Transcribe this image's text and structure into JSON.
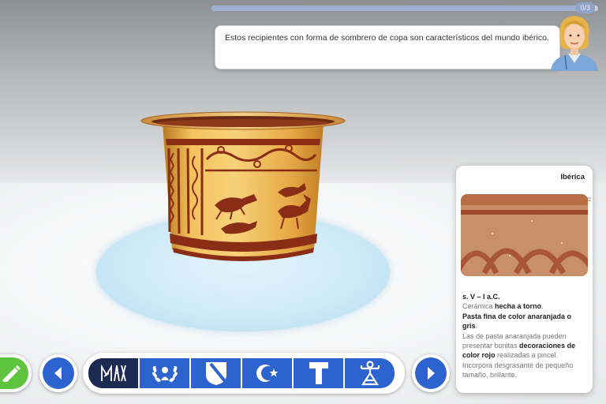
{
  "progress": {
    "count": "0/3",
    "fraction": 0.96
  },
  "dialog": {
    "text": "Estos recipientes con forma de sombrero de copa son característicos del mundo ibérico."
  },
  "info_card": {
    "title": "Ibérica",
    "date": "s. V – I a.C.",
    "line1_pre": "Cerámica ",
    "line1_bold": "hecha a torno",
    "line1_post": ".",
    "line2_bold": "Pasta fina de color anaranjada o gris",
    "line2_post": ".",
    "line3_pre": "Las de pasta anaranjada pueden presentar bonitas ",
    "line3_bold": "decoraciones de color rojo",
    "line3_post": " realizadas a pincel.",
    "line4": "Incorpora desgrasante de pequeño tamaño, brillante."
  },
  "toolbar": {
    "items": [
      {
        "icon": "iberian-script-icon",
        "selected": true
      },
      {
        "icon": "laurel-wreath-icon",
        "selected": false
      },
      {
        "icon": "visigothic-shield-icon",
        "selected": false
      },
      {
        "icon": "crescent-star-icon",
        "selected": false
      },
      {
        "icon": "tau-cross-icon",
        "selected": false
      },
      {
        "icon": "idol-figure-icon",
        "selected": false
      }
    ]
  },
  "colors": {
    "accent_blue": "#2c63cf",
    "selected_navy": "#1c2a52",
    "confirm_green": "#5ec440",
    "pottery_orange": "#e8a63e",
    "pottery_paint": "#8a2d16"
  }
}
